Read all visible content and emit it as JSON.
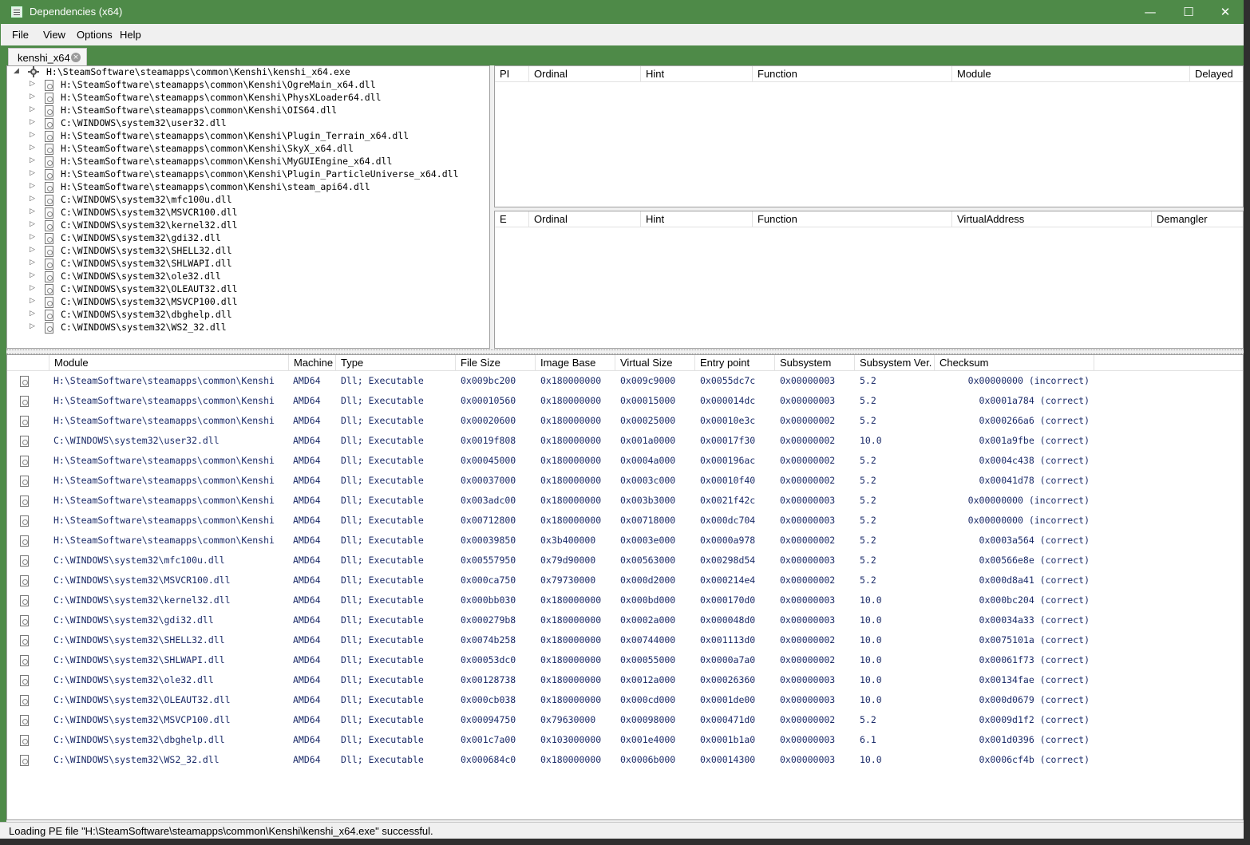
{
  "window": {
    "title": "Dependencies (x64)",
    "minimize_glyph": "—",
    "maximize_glyph": "☐",
    "close_glyph": "✕",
    "accent_color": "#4e8a48"
  },
  "menu": [
    "File",
    "View",
    "Options",
    "Help"
  ],
  "tab": {
    "label": "kenshi_x64",
    "close_glyph": "×"
  },
  "tree": {
    "root": "H:\\SteamSoftware\\steamapps\\common\\Kenshi\\kenshi_x64.exe",
    "children": [
      "H:\\SteamSoftware\\steamapps\\common\\Kenshi\\OgreMain_x64.dll",
      "H:\\SteamSoftware\\steamapps\\common\\Kenshi\\PhysXLoader64.dll",
      "H:\\SteamSoftware\\steamapps\\common\\Kenshi\\OIS64.dll",
      "C:\\WINDOWS\\system32\\user32.dll",
      "H:\\SteamSoftware\\steamapps\\common\\Kenshi\\Plugin_Terrain_x64.dll",
      "H:\\SteamSoftware\\steamapps\\common\\Kenshi\\SkyX_x64.dll",
      "H:\\SteamSoftware\\steamapps\\common\\Kenshi\\MyGUIEngine_x64.dll",
      "H:\\SteamSoftware\\steamapps\\common\\Kenshi\\Plugin_ParticleUniverse_x64.dll",
      "H:\\SteamSoftware\\steamapps\\common\\Kenshi\\steam_api64.dll",
      "C:\\WINDOWS\\system32\\mfc100u.dll",
      "C:\\WINDOWS\\system32\\MSVCR100.dll",
      "C:\\WINDOWS\\system32\\kernel32.dll",
      "C:\\WINDOWS\\system32\\gdi32.dll",
      "C:\\WINDOWS\\system32\\SHELL32.dll",
      "C:\\WINDOWS\\system32\\SHLWAPI.dll",
      "C:\\WINDOWS\\system32\\ole32.dll",
      "C:\\WINDOWS\\system32\\OLEAUT32.dll",
      "C:\\WINDOWS\\system32\\MSVCP100.dll",
      "C:\\WINDOWS\\system32\\dbghelp.dll",
      "C:\\WINDOWS\\system32\\WS2_32.dll"
    ]
  },
  "imports": {
    "columns": [
      "PI",
      "Ordinal",
      "Hint",
      "Function",
      "Module",
      "Delayed"
    ]
  },
  "exports": {
    "columns": [
      "E",
      "Ordinal",
      "Hint",
      "Function",
      "VirtualAddress",
      "Demangler"
    ]
  },
  "modules": {
    "columns": [
      "Module",
      "Machine",
      "Type",
      "File Size",
      "Image Base",
      "Virtual Size",
      "Entry point",
      "Subsystem",
      "Subsystem Ver.",
      "Checksum"
    ],
    "rows": [
      [
        "H:\\SteamSoftware\\steamapps\\common\\Kenshi",
        "AMD64",
        "Dll; Executable",
        "0x009bc200",
        "0x180000000",
        "0x009c9000",
        "0x0055dc7c",
        "0x00000003",
        "5.2",
        "0x00000000 (incorrect)"
      ],
      [
        "H:\\SteamSoftware\\steamapps\\common\\Kenshi",
        "AMD64",
        "Dll; Executable",
        "0x00010560",
        "0x180000000",
        "0x00015000",
        "0x000014dc",
        "0x00000003",
        "5.2",
        "0x0001a784 (correct)"
      ],
      [
        "H:\\SteamSoftware\\steamapps\\common\\Kenshi",
        "AMD64",
        "Dll; Executable",
        "0x00020600",
        "0x180000000",
        "0x00025000",
        "0x00010e3c",
        "0x00000002",
        "5.2",
        "0x000266a6 (correct)"
      ],
      [
        "C:\\WINDOWS\\system32\\user32.dll",
        "AMD64",
        "Dll; Executable",
        "0x0019f808",
        "0x180000000",
        "0x001a0000",
        "0x00017f30",
        "0x00000002",
        "10.0",
        "0x001a9fbe (correct)"
      ],
      [
        "H:\\SteamSoftware\\steamapps\\common\\Kenshi",
        "AMD64",
        "Dll; Executable",
        "0x00045000",
        "0x180000000",
        "0x0004a000",
        "0x000196ac",
        "0x00000002",
        "5.2",
        "0x0004c438 (correct)"
      ],
      [
        "H:\\SteamSoftware\\steamapps\\common\\Kenshi",
        "AMD64",
        "Dll; Executable",
        "0x00037000",
        "0x180000000",
        "0x0003c000",
        "0x00010f40",
        "0x00000002",
        "5.2",
        "0x00041d78 (correct)"
      ],
      [
        "H:\\SteamSoftware\\steamapps\\common\\Kenshi",
        "AMD64",
        "Dll; Executable",
        "0x003adc00",
        "0x180000000",
        "0x003b3000",
        "0x0021f42c",
        "0x00000003",
        "5.2",
        "0x00000000 (incorrect)"
      ],
      [
        "H:\\SteamSoftware\\steamapps\\common\\Kenshi",
        "AMD64",
        "Dll; Executable",
        "0x00712800",
        "0x180000000",
        "0x00718000",
        "0x000dc704",
        "0x00000003",
        "5.2",
        "0x00000000 (incorrect)"
      ],
      [
        "H:\\SteamSoftware\\steamapps\\common\\Kenshi",
        "AMD64",
        "Dll; Executable",
        "0x00039850",
        "0x3b400000",
        "0x0003e000",
        "0x0000a978",
        "0x00000002",
        "5.2",
        "0x0003a564 (correct)"
      ],
      [
        "C:\\WINDOWS\\system32\\mfc100u.dll",
        "AMD64",
        "Dll; Executable",
        "0x00557950",
        "0x79d90000",
        "0x00563000",
        "0x00298d54",
        "0x00000003",
        "5.2",
        "0x00566e8e (correct)"
      ],
      [
        "C:\\WINDOWS\\system32\\MSVCR100.dll",
        "AMD64",
        "Dll; Executable",
        "0x000ca750",
        "0x79730000",
        "0x000d2000",
        "0x000214e4",
        "0x00000002",
        "5.2",
        "0x000d8a41 (correct)"
      ],
      [
        "C:\\WINDOWS\\system32\\kernel32.dll",
        "AMD64",
        "Dll; Executable",
        "0x000bb030",
        "0x180000000",
        "0x000bd000",
        "0x000170d0",
        "0x00000003",
        "10.0",
        "0x000bc204 (correct)"
      ],
      [
        "C:\\WINDOWS\\system32\\gdi32.dll",
        "AMD64",
        "Dll; Executable",
        "0x000279b8",
        "0x180000000",
        "0x0002a000",
        "0x000048d0",
        "0x00000003",
        "10.0",
        "0x00034a33 (correct)"
      ],
      [
        "C:\\WINDOWS\\system32\\SHELL32.dll",
        "AMD64",
        "Dll; Executable",
        "0x0074b258",
        "0x180000000",
        "0x00744000",
        "0x001113d0",
        "0x00000002",
        "10.0",
        "0x0075101a (correct)"
      ],
      [
        "C:\\WINDOWS\\system32\\SHLWAPI.dll",
        "AMD64",
        "Dll; Executable",
        "0x00053dc0",
        "0x180000000",
        "0x00055000",
        "0x0000a7a0",
        "0x00000002",
        "10.0",
        "0x00061f73 (correct)"
      ],
      [
        "C:\\WINDOWS\\system32\\ole32.dll",
        "AMD64",
        "Dll; Executable",
        "0x00128738",
        "0x180000000",
        "0x0012a000",
        "0x00026360",
        "0x00000003",
        "10.0",
        "0x00134fae (correct)"
      ],
      [
        "C:\\WINDOWS\\system32\\OLEAUT32.dll",
        "AMD64",
        "Dll; Executable",
        "0x000cb038",
        "0x180000000",
        "0x000cd000",
        "0x0001de00",
        "0x00000003",
        "10.0",
        "0x000d0679 (correct)"
      ],
      [
        "C:\\WINDOWS\\system32\\MSVCP100.dll",
        "AMD64",
        "Dll; Executable",
        "0x00094750",
        "0x79630000",
        "0x00098000",
        "0x000471d0",
        "0x00000002",
        "5.2",
        "0x0009d1f2 (correct)"
      ],
      [
        "C:\\WINDOWS\\system32\\dbghelp.dll",
        "AMD64",
        "Dll; Executable",
        "0x001c7a00",
        "0x103000000",
        "0x001e4000",
        "0x0001b1a0",
        "0x00000003",
        "6.1",
        "0x001d0396 (correct)"
      ],
      [
        "C:\\WINDOWS\\system32\\WS2_32.dll",
        "AMD64",
        "Dll; Executable",
        "0x000684c0",
        "0x180000000",
        "0x0006b000",
        "0x00014300",
        "0x00000003",
        "10.0",
        "0x0006cf4b (correct)"
      ]
    ]
  },
  "status": "Loading PE file \"H:\\SteamSoftware\\steamapps\\common\\Kenshi\\kenshi_x64.exe\" successful."
}
